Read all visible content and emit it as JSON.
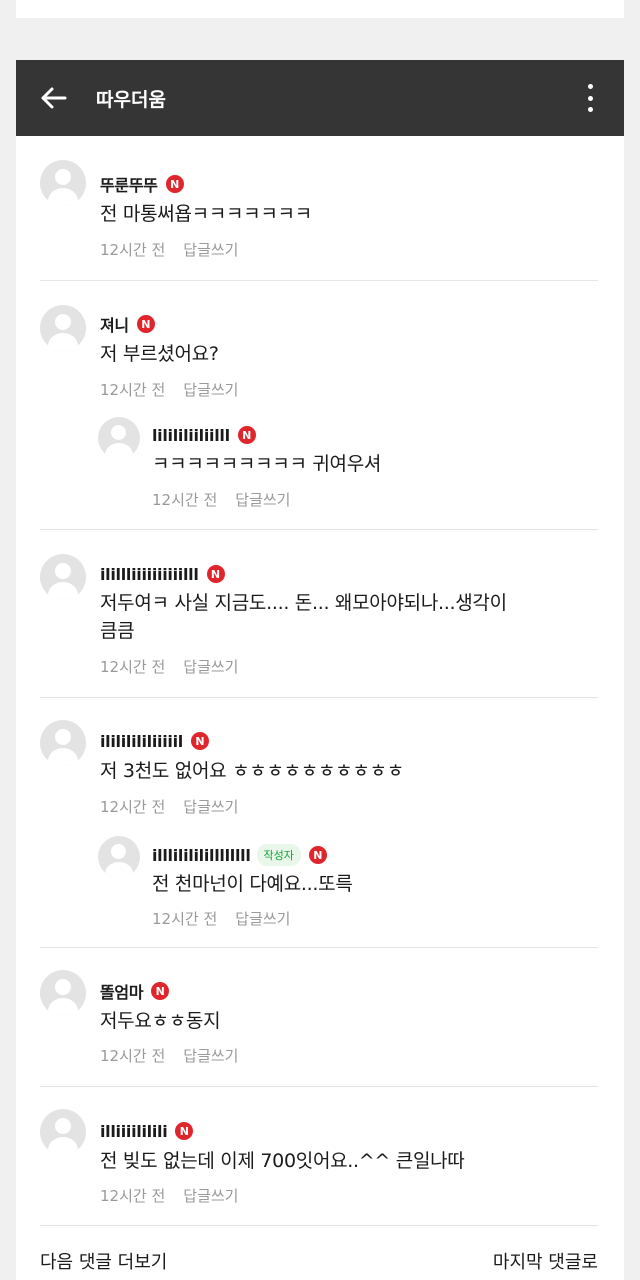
{
  "header": {
    "title": "따우더움",
    "back_icon": "arrow-left-icon",
    "more_icon": "more-vertical-icon"
  },
  "badge_letter": "N",
  "author_label": "작성자",
  "reply_label": "답글쓰기",
  "comments": [
    {
      "nick": "뚜룬뚜뚜",
      "text": "전 마통써욥ㅋㅋㅋㅋㅋㅋㅋ",
      "time": "12시간 전"
    },
    {
      "nick": "져니",
      "text": "저 부르셨어요?",
      "time": "12시간 전"
    },
    {
      "nick": "lilililiiliilll",
      "text": "ㅋㅋㅋㅋㅋㅋㅋㅋㅋ 귀여우셔",
      "time": "12시간 전"
    },
    {
      "nick": "ilillliiiiiiiiiilll",
      "text_line1": "저두여ㅋ 사실 지금도.... 돈... 왜모아야되나...생각이",
      "text_line2": "큼큼",
      "time": "12시간 전"
    },
    {
      "nick": "ilililililiiiiil",
      "text": "저 3천도 없어요 ㅎㅎㅎㅎㅎㅎㅎㅎㅎㅎ",
      "time": "12시간 전"
    },
    {
      "nick": "illlilililillllllll",
      "text": "전 천마넌이 다예요...또륵",
      "time": "12시간 전"
    },
    {
      "nick": "똘엄마",
      "text": "저두요ㅎㅎ동지",
      "time": "12시간 전"
    },
    {
      "nick": "illiiiililili",
      "text": "전 빚도 없는데 이제 700잇어요..^^ 큰일나따",
      "time": "12시간 전"
    }
  ],
  "footer": {
    "more_comments": "다음 댓글 더보기",
    "last_comment": "마지막 댓글로"
  }
}
